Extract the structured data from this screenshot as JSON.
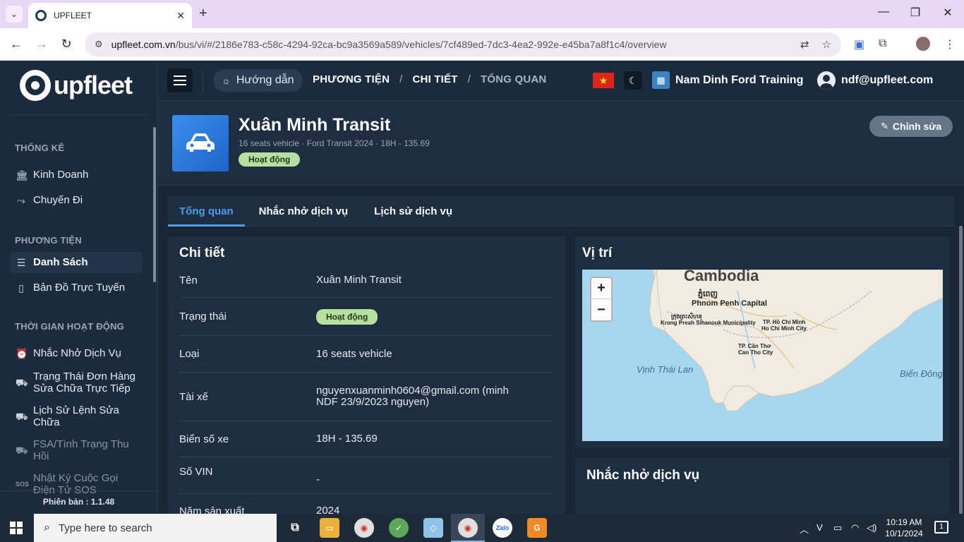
{
  "browser": {
    "tab_title": "UPFLEET",
    "url_host": "upfleet.com.vn",
    "url_path": "/bus/vi/#/2186e783-c58c-4294-92ca-bc9a3569a589/vehicles/7cf489ed-7dc3-4ea2-992e-e45ba7a8f1c4/overview"
  },
  "app": {
    "logo_text": "upfleet",
    "version": "Phiên bản : 1.1.48"
  },
  "sidebar": {
    "sections": [
      {
        "title": "THỐNG KÊ"
      },
      {
        "title": "PHƯƠNG TIỆN"
      },
      {
        "title": "THỜI GIAN HOẠT ĐỘNG"
      }
    ],
    "items": [
      {
        "label": "Kinh Doanh",
        "icon": "bank-icon"
      },
      {
        "label": "Chuyến Đi",
        "icon": "route-icon"
      },
      {
        "label": "Danh Sách",
        "icon": "list-icon"
      },
      {
        "label": "Bản Đồ Trực Tuyến",
        "icon": "map-icon"
      },
      {
        "label": "Nhắc Nhở Dịch Vụ",
        "icon": "alarm-icon"
      },
      {
        "label": "Trạng Thái Đơn Hàng Sửa Chữa Trực Tiếp",
        "icon": "car-repair-icon"
      },
      {
        "label": "Lịch Sử Lệnh Sửa Chữa",
        "icon": "car-history-icon"
      },
      {
        "label": "FSA/Tình Trạng Thu Hồi",
        "icon": "car-recall-icon"
      },
      {
        "label": "Nhật Ký Cuộc Gọi Điện Tử SOS",
        "icon": "sos-icon"
      }
    ]
  },
  "header": {
    "guide_label": "Hướng dẫn",
    "breadcrumb": [
      "PHƯƠNG TIỆN",
      "CHI TIẾT",
      "TỔNG QUAN"
    ],
    "org_name": "Nam Dinh Ford Training",
    "user_email": "ndf@upfleet.com"
  },
  "vehicle": {
    "name": "Xuân Minh Transit",
    "subtitle": "16 seats vehicle · Ford Transit 2024 · 18H - 135.69",
    "status": "Hoạt động",
    "edit_label": "Chỉnh sửa"
  },
  "tabs": [
    "Tổng quan",
    "Nhắc nhở dịch vụ",
    "Lịch sử dịch vụ"
  ],
  "details": {
    "title": "Chi tiết",
    "rows": [
      {
        "key": "Tên",
        "value": "Xuân Minh Transit"
      },
      {
        "key": "Trạng thái",
        "value": "Hoạt động"
      },
      {
        "key": "Loại",
        "value": "16 seats vehicle"
      },
      {
        "key": "Tài xế",
        "value": "nguyenxuanminh0604@gmail.com (minh NDF 23/9/2023 nguyen)"
      },
      {
        "key": "Biển số xe",
        "value": "18H - 135.69"
      },
      {
        "key": "Số VIN",
        "value": "-"
      },
      {
        "key": "Năm sản xuất",
        "value": "2024"
      }
    ]
  },
  "location": {
    "title": "Vị trí",
    "zoom_in": "+",
    "zoom_out": "−",
    "labels": {
      "country": "Cambodia",
      "capital_km": "ភ្នំពេញ",
      "capital": "Phnom Penh Capital",
      "sihanouk_km": "ក្រុងព្រះសីហនុ",
      "sihanouk": "Krong Preah Sihanouk Municipality",
      "hcm1": "TP. Hồ Chí Minh",
      "hcm2": "Ho Chi Minh City",
      "cantho1": "TP. Cần Thơ",
      "cantho2": "Can Tho City",
      "gulf": "Vịnh Thái Lan",
      "east_sea": "Biển Đông"
    }
  },
  "service_reminder": {
    "title": "Nhắc nhở dịch vụ"
  },
  "taskbar": {
    "search_placeholder": "Type here to search",
    "time": "10:19 AM",
    "date": "10/1/2024",
    "notifications": "1"
  }
}
